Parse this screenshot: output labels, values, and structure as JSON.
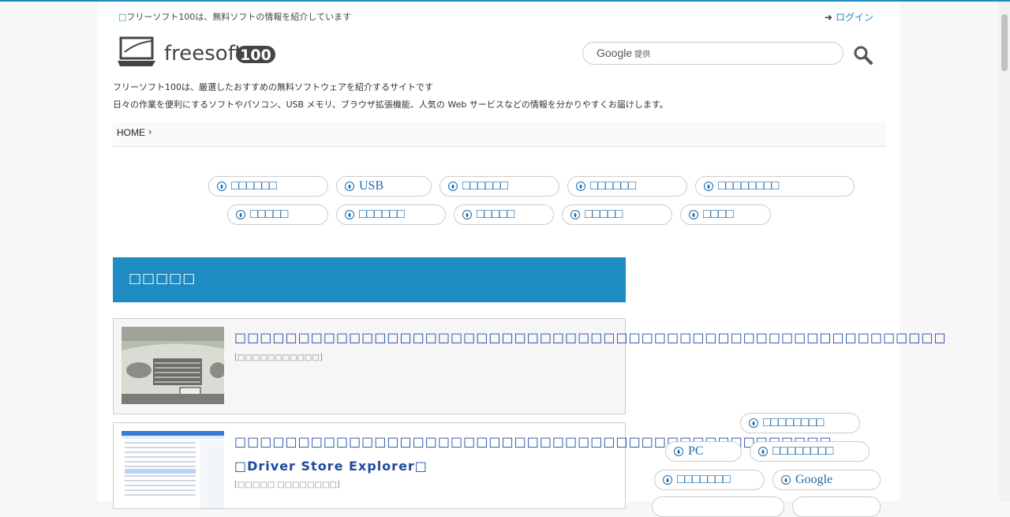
{
  "header": {
    "tagline": "フリーソフト100は、無料ソフトの情報を紹介しています",
    "tagline_mark": "□",
    "login_label": "ログイン",
    "logo_text": "freesoft",
    "logo_badge": "100",
    "search_provider": "Google",
    "search_provider_suffix": "提供",
    "description_line1": "フリーソフト100は、厳選したおすすめの無料ソフトウェアを紹介するサイトです",
    "description_line2": "日々の作業を便利にするソフトやパソコン、USB メモリ、ブラウザ拡張機能、人気の Web サービスなどの情報を分かりやすくお届けします。"
  },
  "breadcrumb": {
    "home": "HOME",
    "chevron": "›"
  },
  "tag_pills": {
    "row1": [
      "□□□□□□",
      "USB",
      "□□□□□□",
      "□□□□□□",
      "□□□□□□□□"
    ],
    "row2": [
      "□□□□□",
      "□□□□□□",
      "□□□□□",
      "□□□□□",
      "□□□□"
    ]
  },
  "section": {
    "title": "□□□□□"
  },
  "articles": [
    {
      "title": "□□□□□□□□□□□□□□□□□□□□□□□□□□□□□□□□□□□□□□□□□□□□□□□□□□□□□□□□",
      "category": "[□□□□□□□□□□□]"
    },
    {
      "title": "□□□□□□□□□□□□□□□□□□□□□□□□□□□□□□□□□□□□□□□□□□□□□□□",
      "title_line2": "□Driver Store Explorer□",
      "category": "[□□□□□ □□□□□□□□]"
    }
  ],
  "sidebar_pills": [
    "□□□□□□□□",
    "PC",
    "□□□□□□□□",
    "□□□□□□□",
    "Google",
    "",
    ""
  ],
  "colors": {
    "accent": "#1e8bc3",
    "link": "#1e4aa0",
    "pill_text": "#1e6aa8"
  }
}
